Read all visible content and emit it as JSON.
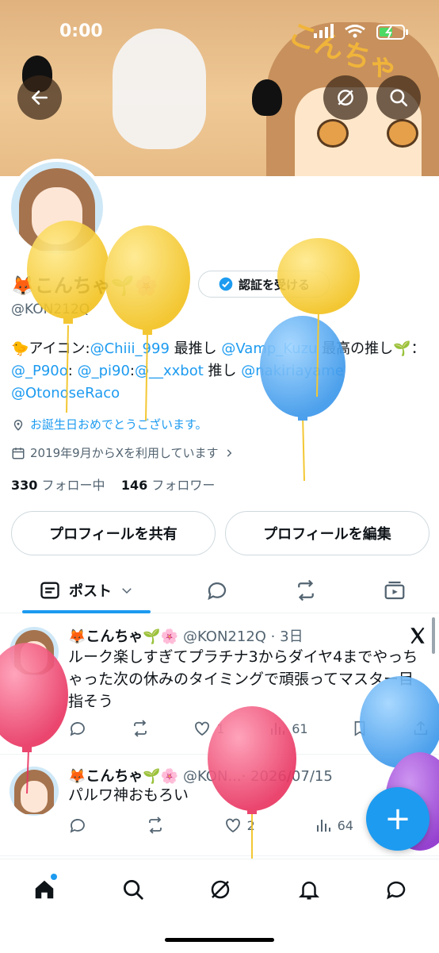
{
  "status_bar": {
    "time": "0:00"
  },
  "profile": {
    "display_name": "🦊こんちゃ🌱🌸",
    "handle": "@KON212Q",
    "verify_label": "認証を受ける",
    "bio": {
      "prefix": "🐤アイコン:",
      "mention1": "@Chiii_999",
      "mid1": " 最推し ",
      "mention2": "@Vamp_Kuzu",
      "mid2": " 最高の推し🌱：",
      "mention3": "@_P90o",
      "mid3": ": ",
      "mention4": "@_pi90",
      "mid4": ":",
      "mention5": "@__xxbot",
      "mid5": " 推し ",
      "mention6": "@nakiriayame",
      "mention7": "@OtonoseRaco"
    },
    "birthday_text": "お誕生日おめでとうございます。",
    "joined_text": "2019年9月からXを利用しています",
    "following_count": "330",
    "following_label": "フォロー中",
    "followers_count": "146",
    "followers_label": "フォロワー",
    "share_button": "プロフィールを共有",
    "edit_button": "プロフィールを編集"
  },
  "tabs": {
    "posts_label": "ポスト"
  },
  "posts": [
    {
      "name": "🦊こんちゃ🌱🌸",
      "meta": "@KON212Q · 3日",
      "text": "ルーク楽しすぎてプラチナ3からダイヤ4までやっちゃった次の休みのタイミングで頑張ってマスター目指そう",
      "likes": "1",
      "views": "61"
    },
    {
      "name": "🦊こんちゃ🌱🌸",
      "meta": "@KON...· 2026/07/15",
      "text": "パルワ神おもろい",
      "likes": "2",
      "views": "64"
    }
  ],
  "fab_label": "+",
  "icons": [
    "back-arrow-icon",
    "grok-icon",
    "search-icon",
    "verified-icon",
    "location-icon",
    "calendar-icon",
    "chevron-right-icon",
    "post-list-icon",
    "chevron-down-icon",
    "reply-icon",
    "repost-icon",
    "like-icon",
    "views-icon",
    "bookmark-icon",
    "share-icon",
    "home-icon",
    "x-logo-icon",
    "notification-icon",
    "messages-icon"
  ],
  "colors": {
    "accent": "#1d9bf0",
    "text": "#0f1419",
    "secondary": "#536471",
    "balloon_yellow": "#f6cd2c",
    "balloon_blue": "#4aa8f2",
    "balloon_pink": "#ef4f77",
    "balloon_purple": "#9a3bd6"
  }
}
